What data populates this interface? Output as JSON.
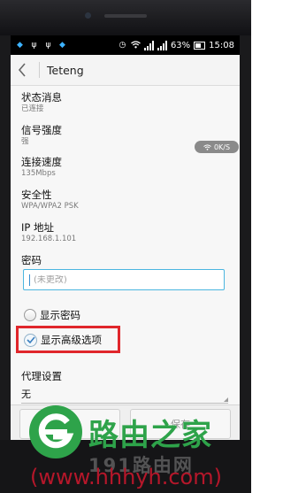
{
  "status_bar": {
    "battery": "63%",
    "time": "15:08"
  },
  "title_bar": {
    "title": "Teteng"
  },
  "info_rows": [
    {
      "label": "状态消息",
      "value": "已连接"
    },
    {
      "label": "信号强度",
      "value": "强"
    },
    {
      "label": "连接速度",
      "value": "135Mbps"
    },
    {
      "label": "安全性",
      "value": "WPA/WPA2 PSK"
    },
    {
      "label": "IP 地址",
      "value": "192.168.1.101"
    }
  ],
  "speed_indicator": "0K/S",
  "password": {
    "label": "密码",
    "placeholder": "(未更改)"
  },
  "show_password": {
    "label": "显示密码",
    "checked": false
  },
  "show_advanced": {
    "label": "显示高级选项",
    "checked": true
  },
  "proxy": {
    "label": "代理设置",
    "value": "无"
  },
  "buttons": {
    "cancel": "取消",
    "save": "保存"
  },
  "watermark": {
    "brand": "路由之家",
    "sub": "191路由网",
    "url": "(www.hhhyh.com)"
  },
  "colors": {
    "highlight": "#e0262b",
    "accent": "#4bb6e0",
    "brand_green": "#2ea34a",
    "url_red": "#b5172a"
  }
}
